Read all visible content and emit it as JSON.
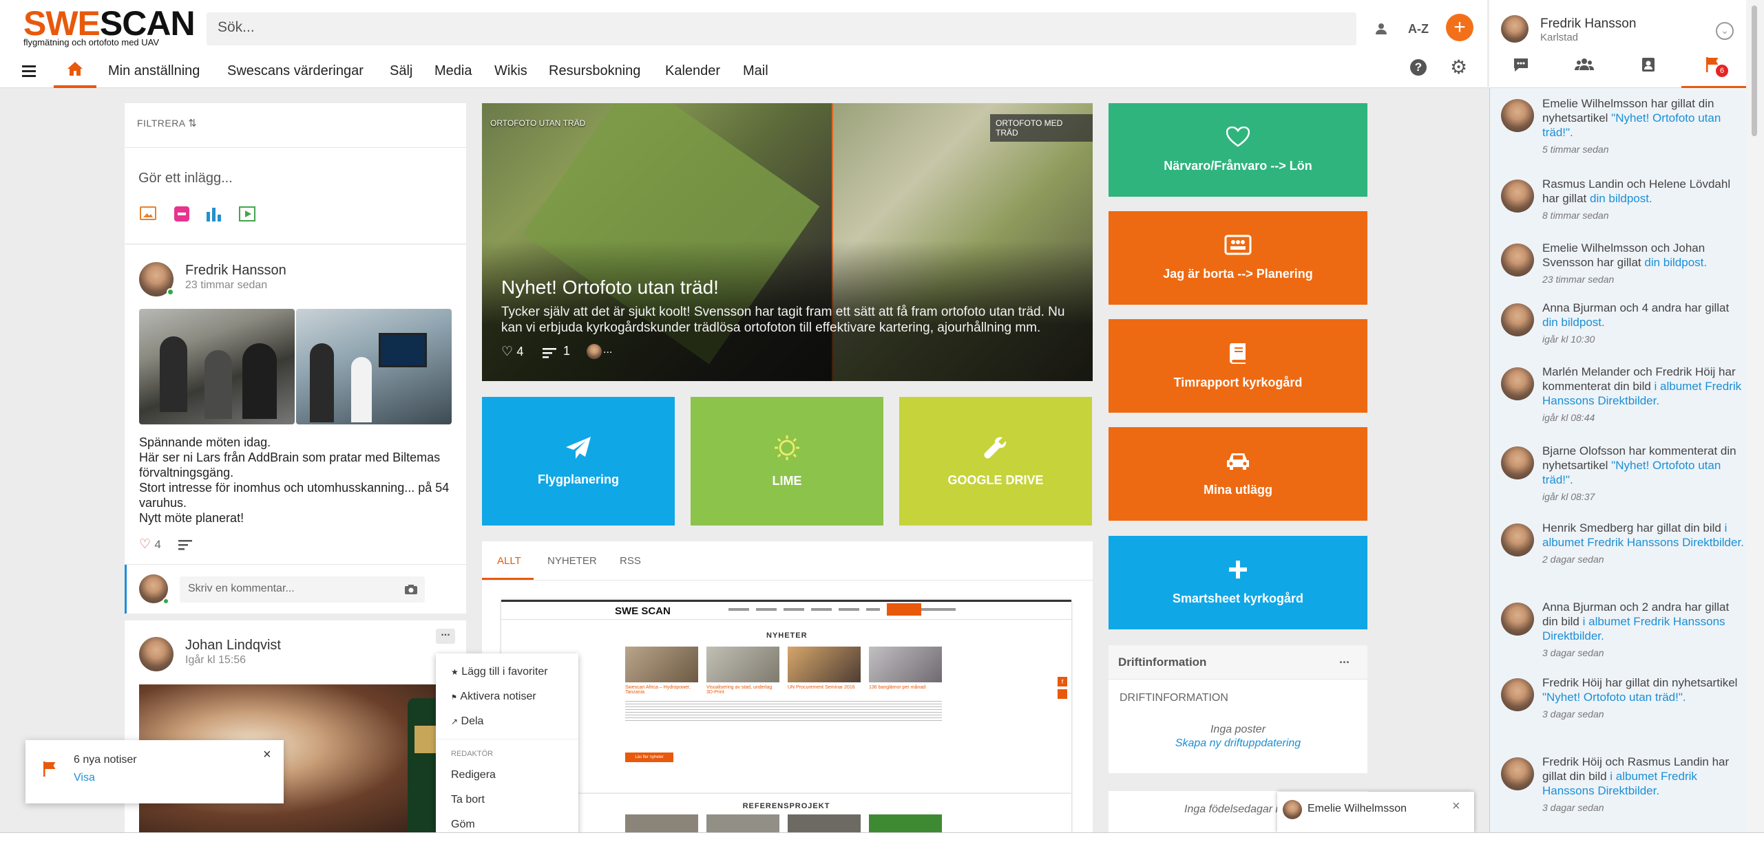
{
  "brand": {
    "logo_text_a": "SWE",
    "logo_text_b": "SCAN",
    "tagline": "flygmätning och ortofoto med UAV"
  },
  "search": {
    "placeholder": "Sök..."
  },
  "header": {
    "az_label": "A-Z"
  },
  "nav": {
    "items": [
      "Min anställning",
      "Swescans värderingar",
      "Sälj",
      "Media",
      "Wikis",
      "Resursbokning",
      "Kalender",
      "Mail"
    ]
  },
  "user": {
    "name": "Fredrik Hansson",
    "location": "Karlstad"
  },
  "right_tabs": {
    "flag_badge": "6"
  },
  "notifications": [
    {
      "text": "Emelie Wilhelmsson har gillat din nyhetsartikel ",
      "link": "\"Nyhet! Ortofoto utan träd!\".",
      "time": "5 timmar sedan"
    },
    {
      "text": "Rasmus Landin och Helene Lövdahl har gillat ",
      "link": "din bildpost.",
      "time": "8 timmar sedan"
    },
    {
      "text": "Emelie Wilhelmsson och Johan Svensson har gillat ",
      "link": "din bildpost.",
      "time": "23 timmar sedan"
    },
    {
      "text": "Anna Bjurman och 4 andra har gillat ",
      "link": "din bildpost.",
      "time": "igår kl 10:30"
    },
    {
      "text": "Marlén Melander och Fredrik Höij har kommenterat din bild ",
      "link": "i albumet Fredrik Hanssons Direktbilder.",
      "time": "igår kl 08:44"
    },
    {
      "text": "Bjarne Olofsson har kommenterat din nyhetsartikel ",
      "link": "\"Nyhet! Ortofoto utan träd!\".",
      "time": "igår kl 08:37"
    },
    {
      "text": "Henrik Smedberg har gillat din bild ",
      "link": "i albumet Fredrik Hanssons Direktbilder.",
      "time": "2 dagar sedan"
    },
    {
      "text": "Anna Bjurman och 2 andra har gillat din bild ",
      "link": "i albumet Fredrik Hanssons Direktbilder.",
      "time": "3 dagar sedan"
    },
    {
      "text": "Fredrik Höij har gillat din nyhetsartikel ",
      "link": "\"Nyhet! Ortofoto utan träd!\".",
      "time": "3 dagar sedan"
    },
    {
      "text": "Fredrik Höij och Rasmus Landin har gillat din bild ",
      "link": "i albumet Fredrik Hanssons Direktbilder.",
      "time": "3 dagar sedan"
    }
  ],
  "feed": {
    "filter_label": "FILTRERA",
    "compose_placeholder": "Gör ett inlägg...",
    "post1": {
      "author": "Fredrik Hansson",
      "time": "23 timmar sedan",
      "lines": [
        "Spännande möten idag.",
        "Här ser ni Lars från AddBrain som pratar med Biltemas förvaltningsgäng.",
        "Stort intresse för inomhus och utomhusskanning... på 54 varuhus.",
        "Nytt möte planerat!"
      ],
      "likes": "4",
      "comment_placeholder": "Skriv en kommentar..."
    },
    "post2": {
      "author": "Johan Lindqvist",
      "time": "Igår kl 15:56",
      "more": "..."
    }
  },
  "hero": {
    "label_left": "ORTOFOTO UTAN TRÄD",
    "label_right": "ORTOFOTO MED TRÄD",
    "title": "Nyhet! Ortofoto utan träd!",
    "text": "Tycker själv att det är sjukt koolt! Svensson har tagit fram ett sätt att få fram ortofoto utan träd. Nu kan vi erbjuda kyrkogårdskunder trädlösa ortofoton till effektivare kartering, ajourhållning mm.",
    "likes": "4",
    "comments": "1",
    "more": "..."
  },
  "tiles_mid": [
    {
      "label": "Flygplanering",
      "color": "#10a7e7",
      "icon": "paper-plane"
    },
    {
      "label": "LIME",
      "color": "#8cc34b",
      "icon": "sun"
    },
    {
      "label": "GOOGLE DRIVE",
      "color": "#c6d33b",
      "icon": "wrench"
    }
  ],
  "tiles_right": [
    {
      "label": "Närvaro/Frånvaro --> Lön",
      "color": "#2fb47d",
      "icon": "heart"
    },
    {
      "label": "Jag är borta --> Planering",
      "color": "#ee6a12",
      "icon": "group"
    },
    {
      "label": "Timrapport kyrkogård",
      "color": "#ee6a12",
      "icon": "book"
    },
    {
      "label": "Mina utlägg",
      "color": "#ee6a12",
      "icon": "car"
    },
    {
      "label": "Smartsheet kyrkogård",
      "color": "#10a7e7",
      "icon": "plus"
    }
  ],
  "news_tabs": [
    "ALLT",
    "NYHETER",
    "RSS"
  ],
  "preview": {
    "logo": "SWE SCAN",
    "heading": "NYHETER",
    "heading2": "REFERENSPROJEKT",
    "articles": [
      "Swescan Africa – Hydropower, Tanzania",
      "Visualisering av stad, underlag 3D-Print",
      "UN Procurement Seminar 2016",
      "136 banglämor per månad"
    ],
    "button": "Läs fler nyheter"
  },
  "drift": {
    "title": "Driftinformation",
    "subtitle": "DRIFTINFORMATION",
    "empty": "Inga poster",
    "create_link": "Skapa ny driftuppdatering",
    "more": "..."
  },
  "birthday": {
    "text": "Inga födelsedagar idag"
  },
  "chat": {
    "name": "Emelie Wilhelmsson"
  },
  "menu": {
    "items": [
      "Lägg till i favoriter",
      "Aktivera notiser",
      "Dela"
    ],
    "section": "REDAKTÖR",
    "edit": [
      "Redigera",
      "Ta bort",
      "Göm"
    ]
  },
  "toast": {
    "title": "6 nya notiser",
    "link": "Visa"
  },
  "colors": {
    "accent": "#e8590c",
    "link": "#1a8fd6"
  }
}
